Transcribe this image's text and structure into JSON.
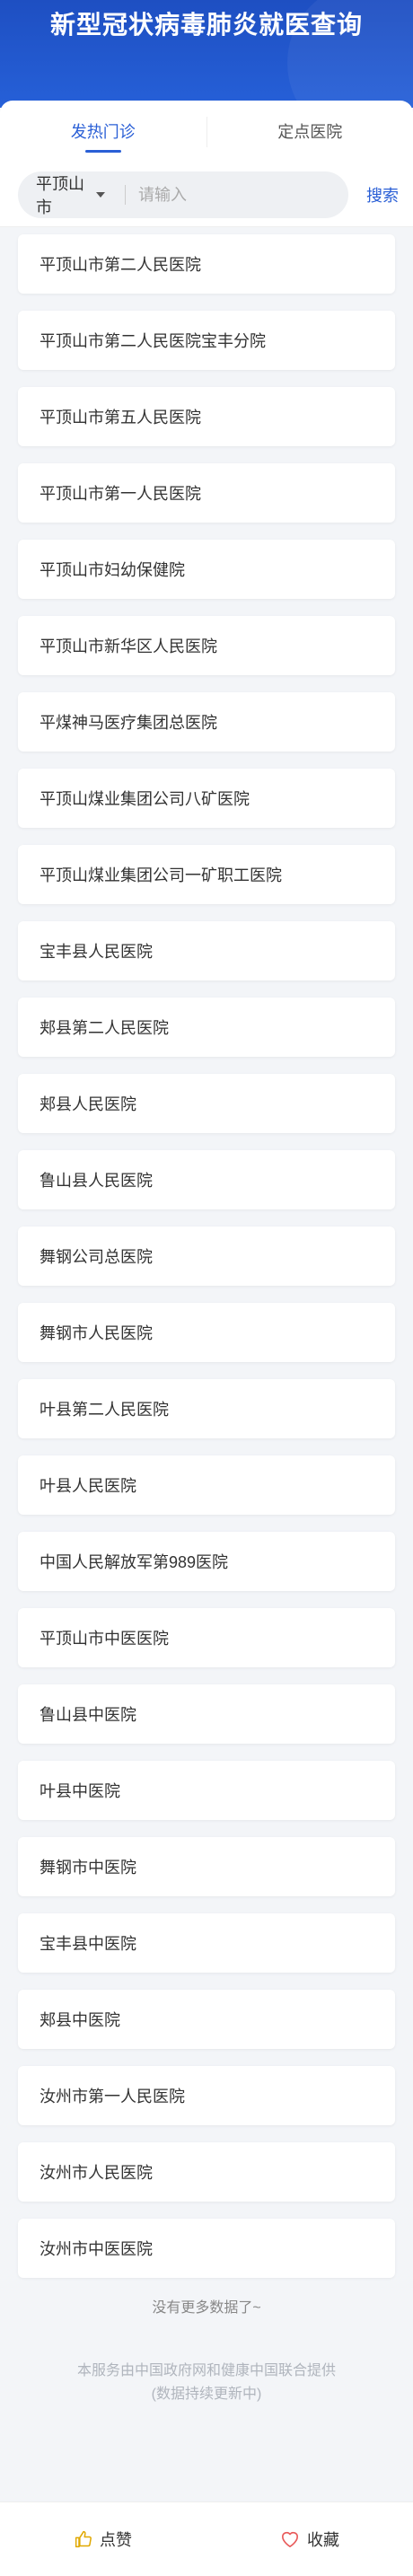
{
  "header": {
    "title": "新型冠状病毒肺炎就医查询"
  },
  "tabs": [
    {
      "label": "发热门诊"
    },
    {
      "label": "定点医院"
    }
  ],
  "search": {
    "city": "平顶山市",
    "placeholder": "请输入",
    "button": "搜索"
  },
  "hospitals": [
    "平顶山市第二人民医院",
    "平顶山市第二人民医院宝丰分院",
    "平顶山市第五人民医院",
    "平顶山市第一人民医院",
    "平顶山市妇幼保健院",
    "平顶山市新华区人民医院",
    "平煤神马医疗集团总医院",
    "平顶山煤业集团公司八矿医院",
    "平顶山煤业集团公司一矿职工医院",
    "宝丰县人民医院",
    "郏县第二人民医院",
    "郏县人民医院",
    "鲁山县人民医院",
    "舞钢公司总医院",
    "舞钢市人民医院",
    "叶县第二人民医院",
    "叶县人民医院",
    "中国人民解放军第989医院",
    "平顶山市中医医院",
    "鲁山县中医院",
    "叶县中医院",
    "舞钢市中医院",
    "宝丰县中医院",
    "郏县中医院",
    "汝州市第一人民医院",
    "汝州市人民医院",
    "汝州市中医医院"
  ],
  "no_more": "没有更多数据了~",
  "footnote": {
    "line1": "本服务由中国政府网和健康中国联合提供",
    "line2": "(数据持续更新中)"
  },
  "bottom_bar": {
    "like": "点赞",
    "favorite": "收藏"
  },
  "colors": {
    "header": "#2660d8",
    "accent": "#2a5fd6",
    "like_icon": "#e0a800",
    "favorite_icon": "#e85a5a"
  }
}
